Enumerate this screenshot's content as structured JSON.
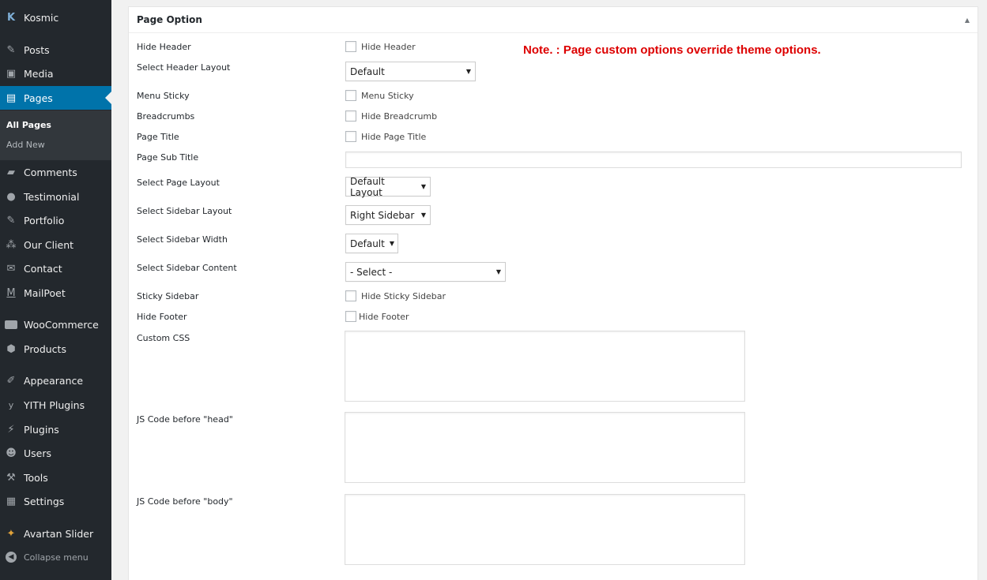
{
  "sidebar": {
    "brand": "Kosmic",
    "items": [
      {
        "label": "Posts",
        "icon": "pin-icon"
      },
      {
        "label": "Media",
        "icon": "media-icon"
      },
      {
        "label": "Pages",
        "icon": "pages-icon"
      },
      {
        "label": "Comments",
        "icon": "comment-icon"
      },
      {
        "label": "Testimonial",
        "icon": "speech-icon"
      },
      {
        "label": "Portfolio",
        "icon": "pin-icon"
      },
      {
        "label": "Our Client",
        "icon": "group-icon"
      },
      {
        "label": "Contact",
        "icon": "mail-icon"
      },
      {
        "label": "MailPoet",
        "icon": "mailpoet-icon"
      },
      {
        "label": "WooCommerce",
        "icon": "woo-icon"
      },
      {
        "label": "Products",
        "icon": "box-icon"
      },
      {
        "label": "Appearance",
        "icon": "brush-icon"
      },
      {
        "label": "YITH Plugins",
        "icon": "yith-icon"
      },
      {
        "label": "Plugins",
        "icon": "plug-icon"
      },
      {
        "label": "Users",
        "icon": "user-icon"
      },
      {
        "label": "Tools",
        "icon": "wrench-icon"
      },
      {
        "label": "Settings",
        "icon": "settings-icon"
      },
      {
        "label": "Avartan Slider",
        "icon": "slider-icon"
      }
    ],
    "submenu": [
      "All Pages",
      "Add New"
    ],
    "collapse": "Collapse menu"
  },
  "panel": {
    "title": "Page Option",
    "note": "Note. : Page custom options override theme options.",
    "fields": {
      "hide_header": {
        "label": "Hide Header",
        "option": "Hide Header"
      },
      "header_layout": {
        "label": "Select Header Layout",
        "value": "Default"
      },
      "menu_sticky": {
        "label": "Menu Sticky",
        "option": "Menu Sticky"
      },
      "breadcrumbs": {
        "label": "Breadcrumbs",
        "option": "Hide Breadcrumb"
      },
      "page_title": {
        "label": "Page Title",
        "option": "Hide Page Title"
      },
      "page_sub_title": {
        "label": "Page Sub Title",
        "value": ""
      },
      "page_layout": {
        "label": "Select Page Layout",
        "value": "Default Layout"
      },
      "sidebar_layout": {
        "label": "Select Sidebar Layout",
        "value": "Right Sidebar"
      },
      "sidebar_width": {
        "label": "Select Sidebar Width",
        "value": "Default"
      },
      "sidebar_content": {
        "label": "Select Sidebar Content",
        "value": "- Select -"
      },
      "sticky_sidebar": {
        "label": "Sticky Sidebar",
        "option": "Hide Sticky Sidebar"
      },
      "hide_footer": {
        "label": "Hide Footer",
        "option": "Hide Footer"
      },
      "custom_css": {
        "label": "Custom CSS"
      },
      "js_head": {
        "label": "JS Code before \"head\""
      },
      "js_body": {
        "label": "JS Code before \"body\""
      }
    }
  },
  "colors": {
    "sidebar_bg": "#23282d",
    "active": "#0073aa",
    "note": "#dd0000"
  }
}
